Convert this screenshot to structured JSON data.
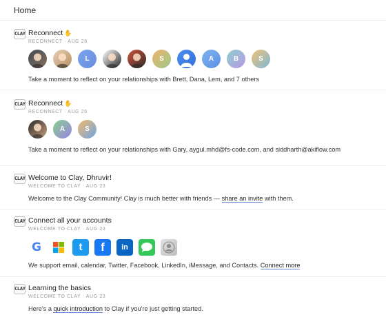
{
  "header": {
    "title": "Home"
  },
  "feed": [
    {
      "logo": "CLAY",
      "title": "Reconnect",
      "emoji": "✋",
      "meta": "RECONNECT · AUG 26",
      "avatars": [
        {
          "type": "photo",
          "letter": "",
          "colors": [
            "#3d4a55",
            "#8a7060"
          ]
        },
        {
          "type": "photo",
          "letter": "",
          "colors": [
            "#e8d2b8",
            "#b58d5e"
          ]
        },
        {
          "type": "letter",
          "letter": "L",
          "colors": [
            "#7aa6ea",
            "#6b8be0"
          ]
        },
        {
          "type": "photo",
          "letter": "",
          "colors": [
            "#ffffff",
            "#2a2a2a"
          ]
        },
        {
          "type": "photo",
          "letter": "",
          "colors": [
            "#d1533a",
            "#2e2b2b"
          ]
        },
        {
          "type": "letter",
          "letter": "S",
          "colors": [
            "#f2b36b",
            "#98c98a"
          ]
        },
        {
          "type": "person",
          "letter": "",
          "colors": [
            "#4f8ef0",
            "#2f6fd8"
          ]
        },
        {
          "type": "letter",
          "letter": "A",
          "colors": [
            "#7cb5ef",
            "#5f8fe5"
          ]
        },
        {
          "type": "letter",
          "letter": "B",
          "colors": [
            "#8ed0c9",
            "#b797e8"
          ]
        },
        {
          "type": "letter",
          "letter": "S",
          "colors": [
            "#f0c276",
            "#7db8d8"
          ]
        }
      ],
      "desc": "Take a moment to reflect on your relationships with Brett, Dana, Lem, and 7 others"
    },
    {
      "logo": "CLAY",
      "title": "Reconnect",
      "emoji": "✋",
      "meta": "RECONNECT · AUG 25",
      "avatars": [
        {
          "type": "photo",
          "letter": "",
          "colors": [
            "#2b2b2b",
            "#c79d7c"
          ]
        },
        {
          "type": "letter",
          "letter": "A",
          "colors": [
            "#86cf8a",
            "#9a84e6"
          ]
        },
        {
          "type": "letter",
          "letter": "S",
          "colors": [
            "#f2b96a",
            "#6fa5e6"
          ]
        }
      ],
      "desc": "Take a moment to reflect on your relationships with Gary, aygul.mhd@fs-code.com, and siddharth@akiflow.com"
    },
    {
      "logo": "CLAY",
      "title": "Welcome to Clay, Dhruvir!",
      "meta": "WELCOME TO CLAY · AUG 23",
      "desc_before": "Welcome to the Clay Community! Clay is much better with friends — ",
      "desc_link": "share an invite",
      "desc_after": " with them."
    },
    {
      "logo": "CLAY",
      "title": "Connect all your accounts",
      "meta": "WELCOME TO CLAY · AUG 23",
      "icons": [
        {
          "name": "google-icon",
          "glyph": "G",
          "bg": "#ffffff",
          "fg": "#4285f4"
        },
        {
          "name": "microsoft-icon",
          "glyph": "",
          "bg": "#ffffff",
          "fg": "#000000"
        },
        {
          "name": "twitter-icon",
          "glyph": "t",
          "bg": "#1d9bf0",
          "fg": "#ffffff"
        },
        {
          "name": "facebook-icon",
          "glyph": "f",
          "bg": "#1877f2",
          "fg": "#ffffff"
        },
        {
          "name": "linkedin-icon",
          "glyph": "in",
          "bg": "#0a66c2",
          "fg": "#ffffff"
        },
        {
          "name": "imessage-icon",
          "glyph": "",
          "bg": "#34c759",
          "fg": "#ffffff"
        },
        {
          "name": "contacts-icon",
          "glyph": "",
          "bg": "#cfcfcf",
          "fg": "#ffffff"
        }
      ],
      "desc_before": "We support email, calendar, Twitter, Facebook, LinkedIn, iMessage, and Contacts. ",
      "desc_link": "Connect more",
      "desc_after": ""
    },
    {
      "logo": "CLAY",
      "title": "Learning the basics",
      "meta": "WELCOME TO CLAY · AUG 23",
      "desc_before": "Here's a ",
      "desc_link": "quick introduction",
      "desc_after": " to Clay if you're just getting started."
    }
  ]
}
